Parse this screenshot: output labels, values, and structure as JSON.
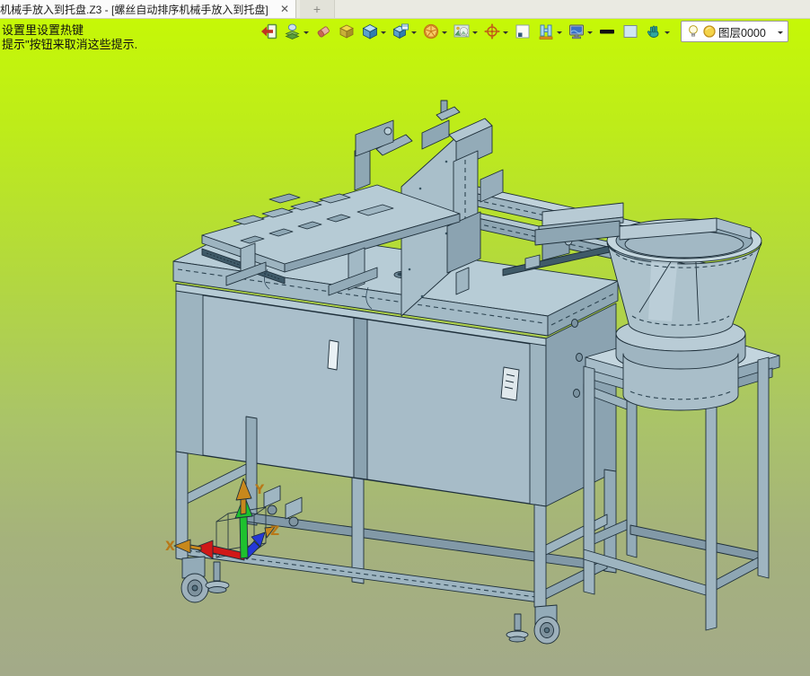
{
  "window": {
    "tab": {
      "title": "机械手放入到托盘.Z3 - [螺丝自动排序机械手放入到托盘]",
      "close_glyph": "✕",
      "new_tab_glyph": "+"
    }
  },
  "viewport": {
    "hints": {
      "line1": "设置里设置热键",
      "line2": "提示\"按钮来取消这些提示."
    },
    "background": {
      "top": "#c7fa03",
      "bottom": "#a3aa89"
    }
  },
  "toolbar": {
    "icons": [
      {
        "name": "exit-icon",
        "has_dropdown": false
      },
      {
        "name": "hand-layers-icon",
        "has_dropdown": true
      },
      {
        "name": "eraser-icon",
        "has_dropdown": false
      },
      {
        "name": "isometric-box-icon",
        "has_dropdown": false
      },
      {
        "name": "shaded-cube-icon",
        "has_dropdown": true
      },
      {
        "name": "cube-window-icon",
        "has_dropdown": true
      },
      {
        "name": "wireframe-sphere-icon",
        "has_dropdown": true
      },
      {
        "name": "image-zoom-icon",
        "has_dropdown": true
      },
      {
        "name": "crosshair-target-icon",
        "has_dropdown": true
      },
      {
        "name": "corner-square-icon",
        "has_dropdown": false
      },
      {
        "name": "section-profile-icon",
        "has_dropdown": true
      },
      {
        "name": "monitor-icon",
        "has_dropdown": true
      },
      {
        "name": "line-width-icon",
        "has_dropdown": false
      },
      {
        "name": "color-swatch-icon",
        "has_dropdown": false
      },
      {
        "name": "pan-hand-icon",
        "has_dropdown": true
      }
    ],
    "layer_selector": {
      "value": "图层0000",
      "icons": [
        "bulb-icon",
        "layer-circle-icon"
      ]
    }
  },
  "axis_triad": {
    "labels": {
      "x": "X",
      "y": "Y",
      "z": "Z"
    },
    "colors": {
      "x": "#d01818",
      "y": "#1ec12e",
      "z": "#2438d8",
      "label": "#b87818"
    }
  },
  "model": {
    "subject": "screw auto-sorting robot cell: table machine with robot gantry and vibratory bowl feeder on stand",
    "parts": [
      "gantry-rail-assembly",
      "z-axis-mechanism",
      "tray-fixture-plate",
      "machine-table",
      "machine-cabinet",
      "machine-frame",
      "casters",
      "feeder-rail",
      "bowl-stand",
      "vibratory-bowl-feeder",
      "axis-triad"
    ],
    "colors": {
      "body_light": "#c3d5de",
      "body": "#a9bfca",
      "body_dark": "#8ea6b3",
      "edge": "#1e2f3a"
    }
  }
}
